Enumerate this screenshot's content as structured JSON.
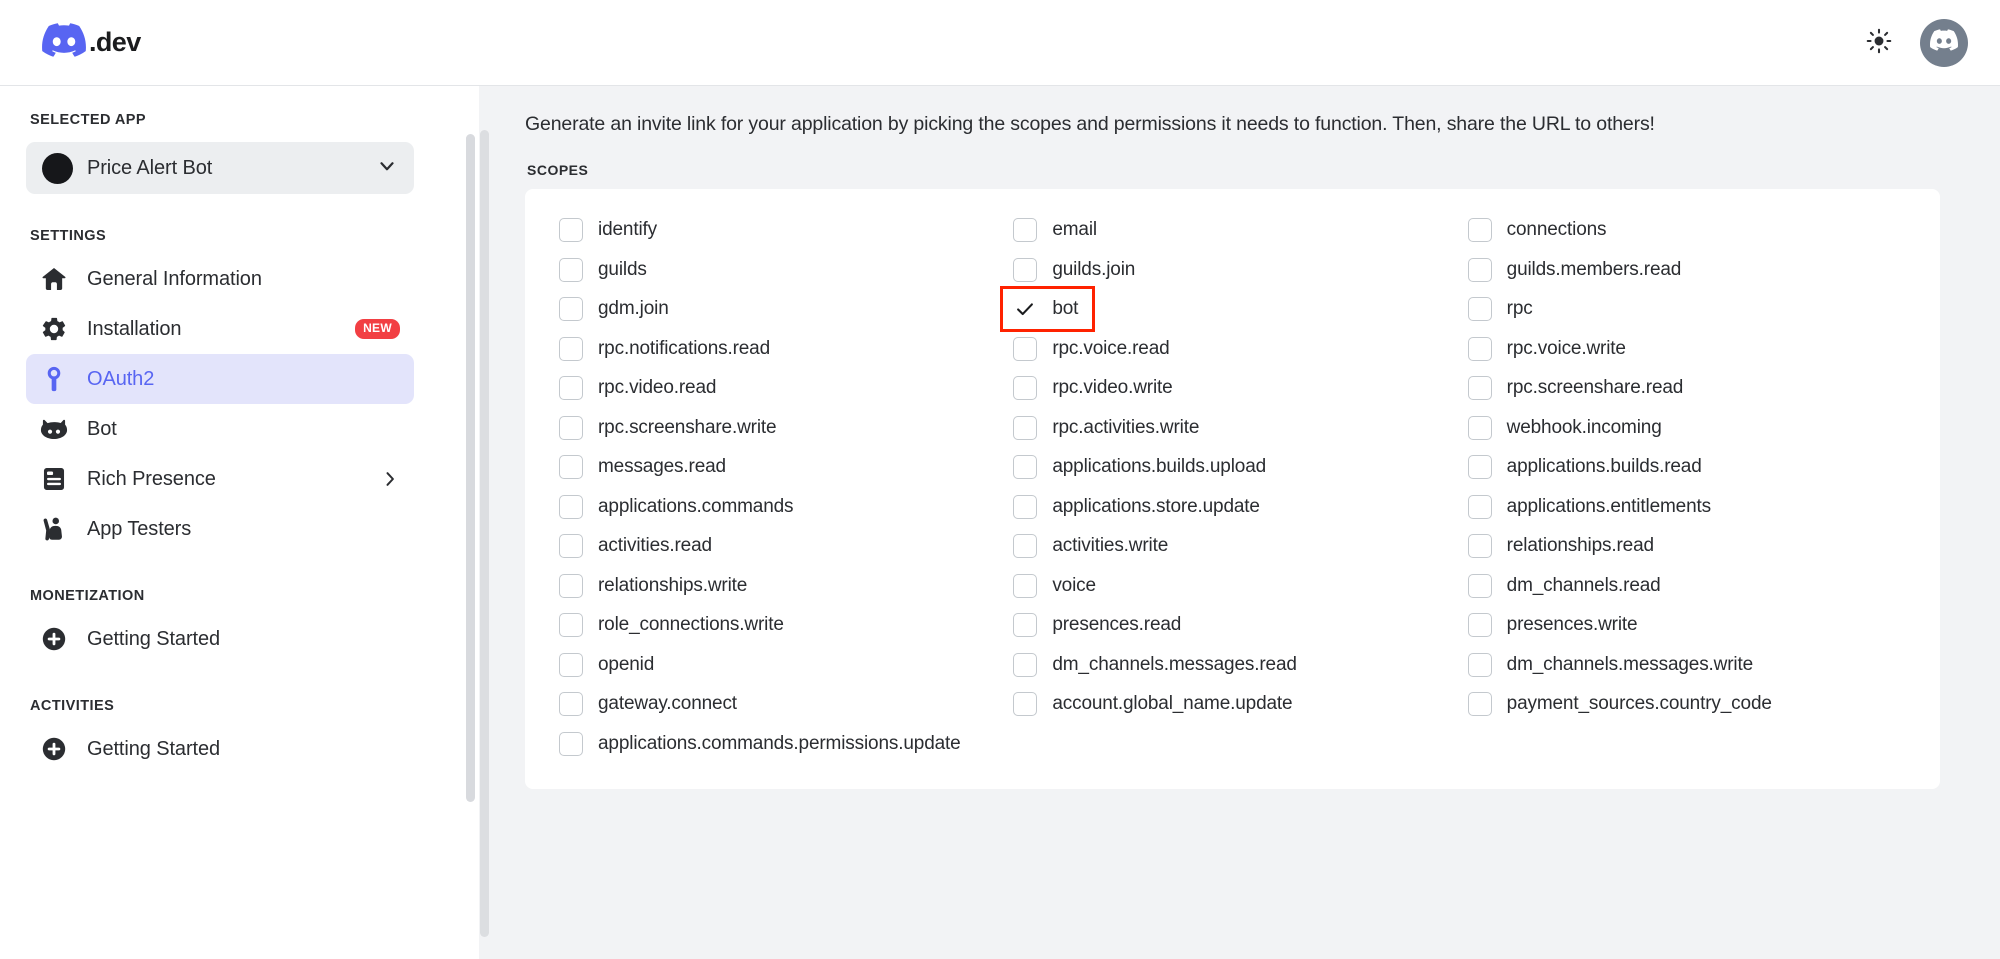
{
  "topbar": {
    "brand_suffix": ".dev",
    "brand_logo_icon": "discord-logo-icon",
    "theme_toggle_icon": "sun-icon",
    "avatar_icon": "discord-avatar-icon"
  },
  "sidebar": {
    "selected_app_label": "SELECTED APP",
    "selected_app_name": "Price Alert Bot",
    "selected_app_chevron_icon": "chevron-down-icon",
    "sections": [
      {
        "title": "SETTINGS",
        "items": [
          {
            "label": "General Information",
            "icon": "home-icon",
            "active": false,
            "badge": "",
            "chevron": false
          },
          {
            "label": "Installation",
            "icon": "gear-icon",
            "active": false,
            "badge": "NEW",
            "chevron": false
          },
          {
            "label": "OAuth2",
            "icon": "wrench-icon",
            "active": true,
            "badge": "",
            "chevron": false
          },
          {
            "label": "Bot",
            "icon": "bot-icon",
            "active": false,
            "badge": "",
            "chevron": false
          },
          {
            "label": "Rich Presence",
            "icon": "rich-presence-icon",
            "active": false,
            "badge": "",
            "chevron": true
          },
          {
            "label": "App Testers",
            "icon": "app-testers-icon",
            "active": false,
            "badge": "",
            "chevron": false
          }
        ]
      },
      {
        "title": "MONETIZATION",
        "items": [
          {
            "label": "Getting Started",
            "icon": "plus-circle-icon",
            "active": false,
            "badge": "",
            "chevron": false
          }
        ]
      },
      {
        "title": "ACTIVITIES",
        "items": [
          {
            "label": "Getting Started",
            "icon": "plus-circle-icon",
            "active": false,
            "badge": "",
            "chevron": false
          }
        ]
      }
    ]
  },
  "main": {
    "intro": "Generate an invite link for your application by picking the scopes and permissions it needs to function. Then, share the URL to others!",
    "scopes_label": "SCOPES",
    "scopes": [
      {
        "label": "identify",
        "checked": false,
        "annotated": false
      },
      {
        "label": "email",
        "checked": false,
        "annotated": false
      },
      {
        "label": "connections",
        "checked": false,
        "annotated": false
      },
      {
        "label": "guilds",
        "checked": false,
        "annotated": false
      },
      {
        "label": "guilds.join",
        "checked": false,
        "annotated": false
      },
      {
        "label": "guilds.members.read",
        "checked": false,
        "annotated": false
      },
      {
        "label": "gdm.join",
        "checked": false,
        "annotated": false
      },
      {
        "label": "bot",
        "checked": true,
        "annotated": true
      },
      {
        "label": "rpc",
        "checked": false,
        "annotated": false
      },
      {
        "label": "rpc.notifications.read",
        "checked": false,
        "annotated": false
      },
      {
        "label": "rpc.voice.read",
        "checked": false,
        "annotated": false
      },
      {
        "label": "rpc.voice.write",
        "checked": false,
        "annotated": false
      },
      {
        "label": "rpc.video.read",
        "checked": false,
        "annotated": false
      },
      {
        "label": "rpc.video.write",
        "checked": false,
        "annotated": false
      },
      {
        "label": "rpc.screenshare.read",
        "checked": false,
        "annotated": false
      },
      {
        "label": "rpc.screenshare.write",
        "checked": false,
        "annotated": false
      },
      {
        "label": "rpc.activities.write",
        "checked": false,
        "annotated": false
      },
      {
        "label": "webhook.incoming",
        "checked": false,
        "annotated": false
      },
      {
        "label": "messages.read",
        "checked": false,
        "annotated": false
      },
      {
        "label": "applications.builds.upload",
        "checked": false,
        "annotated": false
      },
      {
        "label": "applications.builds.read",
        "checked": false,
        "annotated": false
      },
      {
        "label": "applications.commands",
        "checked": false,
        "annotated": false
      },
      {
        "label": "applications.store.update",
        "checked": false,
        "annotated": false
      },
      {
        "label": "applications.entitlements",
        "checked": false,
        "annotated": false
      },
      {
        "label": "activities.read",
        "checked": false,
        "annotated": false
      },
      {
        "label": "activities.write",
        "checked": false,
        "annotated": false
      },
      {
        "label": "relationships.read",
        "checked": false,
        "annotated": false
      },
      {
        "label": "relationships.write",
        "checked": false,
        "annotated": false
      },
      {
        "label": "voice",
        "checked": false,
        "annotated": false
      },
      {
        "label": "dm_channels.read",
        "checked": false,
        "annotated": false
      },
      {
        "label": "role_connections.write",
        "checked": false,
        "annotated": false
      },
      {
        "label": "presences.read",
        "checked": false,
        "annotated": false
      },
      {
        "label": "presences.write",
        "checked": false,
        "annotated": false
      },
      {
        "label": "openid",
        "checked": false,
        "annotated": false
      },
      {
        "label": "dm_channels.messages.read",
        "checked": false,
        "annotated": false
      },
      {
        "label": "dm_channels.messages.write",
        "checked": false,
        "annotated": false
      },
      {
        "label": "gateway.connect",
        "checked": false,
        "annotated": false
      },
      {
        "label": "account.global_name.update",
        "checked": false,
        "annotated": false
      },
      {
        "label": "payment_sources.country_code",
        "checked": false,
        "annotated": false
      },
      {
        "label": "applications.commands.permissions.update",
        "checked": false,
        "annotated": false
      }
    ]
  },
  "colors": {
    "brand_blurple": "#5865f2",
    "active_nav_bg": "#e3e4fb",
    "badge_red": "#f23f43",
    "annotation_red": "#ff2200",
    "content_bg": "#f2f3f5"
  }
}
